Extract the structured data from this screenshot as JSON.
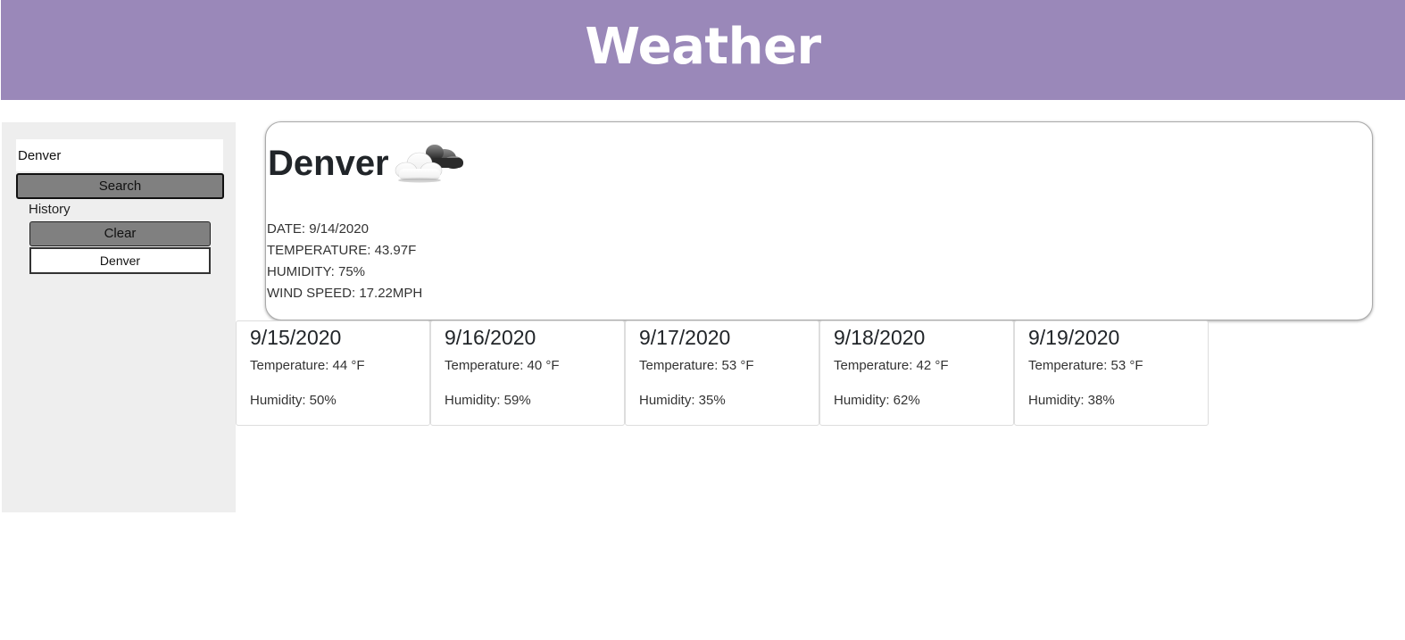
{
  "header": {
    "title": "Weather"
  },
  "sidebar": {
    "search_value": "Denver",
    "search_button": "Search",
    "history_label": "History",
    "clear_button": "Clear",
    "history_items": [
      "Denver"
    ]
  },
  "current": {
    "city": "Denver",
    "icon": "partly-cloudy-icon",
    "date": "DATE: 9/14/2020",
    "temperature": "TEMPERATURE: 43.97F",
    "humidity": "HUMIDITY: 75%",
    "wind_speed": "WIND SPEED: 17.22MPH"
  },
  "forecast": [
    {
      "date": "9/15/2020",
      "temperature": "Temperature: 44 °F",
      "humidity": "Humidity: 50%"
    },
    {
      "date": "9/16/2020",
      "temperature": "Temperature: 40 °F",
      "humidity": "Humidity: 59%"
    },
    {
      "date": "9/17/2020",
      "temperature": "Temperature: 53 °F",
      "humidity": "Humidity: 35%"
    },
    {
      "date": "9/18/2020",
      "temperature": "Temperature: 42 °F",
      "humidity": "Humidity: 62%"
    },
    {
      "date": "9/19/2020",
      "temperature": "Temperature: 53 °F",
      "humidity": "Humidity: 38%"
    }
  ],
  "colors": {
    "header_bg": "#9a88b9",
    "sidebar_bg": "#eeeeee",
    "button_bg": "#808080"
  }
}
